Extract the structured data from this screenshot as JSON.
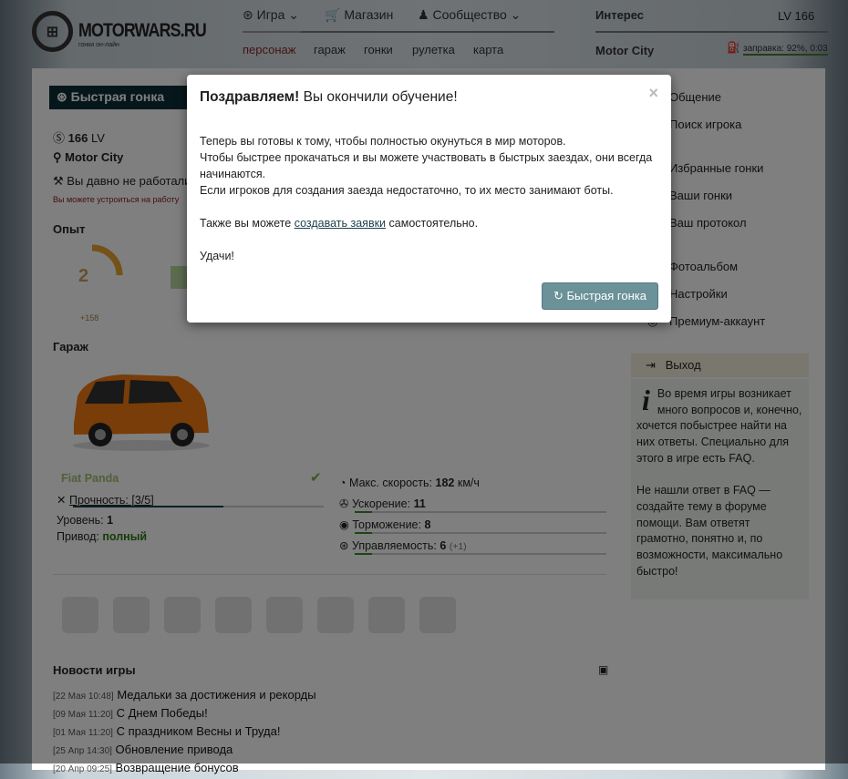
{
  "header": {
    "brand": "MOTORWARS.RU",
    "tagline": "гонки он-лайн",
    "nav": [
      "Игра",
      "Магазин",
      "Сообщество"
    ],
    "subnav": [
      "персонаж",
      "гараж",
      "гонки",
      "рулетка",
      "карта"
    ],
    "interest": "Интерес",
    "level": "LV 166",
    "city": "Motor City",
    "fuel": "заправка: 92%, 0:03"
  },
  "left": {
    "quick_race": "Быстрая гонка",
    "lv_num": "166",
    "lv_unit": "LV",
    "city": "Motor City",
    "work": "Вы давно не работали",
    "work_hint": "Вы можете устроиться на работу",
    "exp_title": "Опыт",
    "exp_badge": "2",
    "exp_gain": "+158",
    "exp_progress": 0.45,
    "garage_title": "Гараж"
  },
  "car": {
    "name": "Fiat Panda",
    "durability": "Прочность: [3/5]",
    "durability_fraction": 0.6,
    "level_label": "Уровень:",
    "level": "1",
    "drive_label": "Привод:",
    "drive": "полный",
    "speed_label": "Макс. скорость:",
    "speed": "182",
    "speed_unit": "км/ч",
    "accel_label": "Ускорение:",
    "accel": "11",
    "brake_label": "Торможение:",
    "brake": "8",
    "handling_label": "Управляемость:",
    "handling": "6",
    "handling_bonus": "(+1)"
  },
  "news": {
    "title": "Новости игры",
    "items": [
      {
        "date": "[22 Мая 10:48]",
        "text": "Медальки за достижения и рекорды"
      },
      {
        "date": "[09 Мая 11:20]",
        "text": "С Днем Победы!"
      },
      {
        "date": "[01 Мая 11:20]",
        "text": "С праздником Весны и Труда!"
      },
      {
        "date": "[25 Апр 14:30]",
        "text": "Обновление привода"
      },
      {
        "date": "[20 Апр 09:25]",
        "text": "Возвращение бонусов"
      }
    ]
  },
  "sidebar": {
    "items": [
      "Общение",
      "Поиск игрока",
      "Избранные гонки",
      "Ваши гонки",
      "Ваш протокол",
      "Фотоальбом",
      "Настройки",
      "Премиум-аккаунт"
    ],
    "exit": "Выход",
    "info1": "Во время игры возникает много вопросов и, конечно, хочется побыстрее найти на них ответы. Специально для этого в игре есть ",
    "faq": "FAQ",
    "info2": "Не нашли ответ в FAQ — создайте тему ",
    "forum": "в форуме помощи",
    "info3": ". Вам ответят грамотно, понятно и, по возможности, максимально быстро!"
  },
  "modal": {
    "title_bold": "Поздравляем!",
    "title_rest": " Вы окончили обучение!",
    "p1": "Теперь вы готовы к тому, чтобы полностью окунуться в мир моторов.",
    "p2": "Чтобы быстрее прокачаться и вы можете участвовать в быстрых заездах, они всегда начинаются.",
    "p3": "Если игроков для создания заезда недостаточно, то их место занимают боты.",
    "p4a": "Также вы можете ",
    "p4link": "создавать заявки",
    "p4b": " самостоятельно.",
    "p5": "Удачи!",
    "button": "Быстрая гонка",
    "close": "×"
  }
}
